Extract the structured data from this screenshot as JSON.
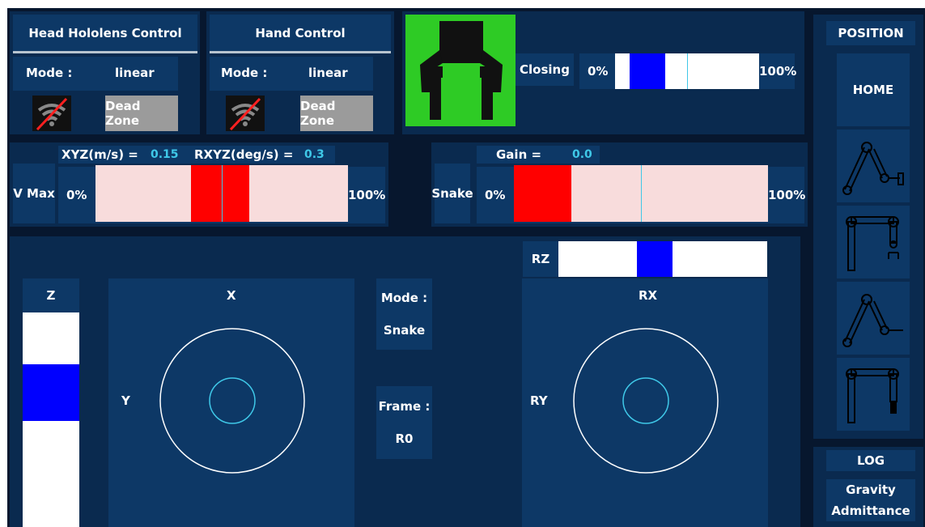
{
  "head_control": {
    "title": "Head Hololens Control",
    "mode_label": "Mode :",
    "mode_value": "linear",
    "dead_zone_label": "Dead Zone",
    "wifi_icon": "wifi-off-icon"
  },
  "hand_control": {
    "title": "Hand Control",
    "mode_label": "Mode :",
    "mode_value": "linear",
    "dead_zone_label": "Dead Zone",
    "wifi_icon": "wifi-off-icon"
  },
  "gripper": {
    "state_label": "Closing",
    "min_label": "0%",
    "max_label": "100%",
    "level": 0.2,
    "icon": "gripper-icon",
    "icon_bg": "#2ecb25"
  },
  "vmax": {
    "label": "V Max",
    "xyz_label": "XYZ(m/s) =",
    "xyz_value": "0.15",
    "rxyz_label": "RXYZ(deg/s) =",
    "rxyz_value": "0.3",
    "min_label": "0%",
    "max_label": "100%",
    "level": 0.55
  },
  "snake": {
    "label": "Snake",
    "gain_label": "Gain =",
    "gain_value": "0.0",
    "min_label": "0%",
    "max_label": "100%",
    "level": 0.18
  },
  "joystick": {
    "z_label": "Z",
    "z_level": 0.5,
    "x_label": "X",
    "y_label": "Y",
    "mode_label": "Mode :",
    "mode_value": "Snake",
    "frame_label": "Frame :",
    "frame_value": "R0",
    "rz_label": "RZ",
    "rz_level": 0.5,
    "rx_label": "RX",
    "ry_label": "RY"
  },
  "sidebar": {
    "position_label": "POSITION",
    "home_label": "HOME",
    "poses": [
      {
        "icon": "robot-arm-pose-1-icon"
      },
      {
        "icon": "robot-arm-pose-2-icon"
      },
      {
        "icon": "robot-arm-pose-3-icon"
      },
      {
        "icon": "robot-arm-pose-4-icon"
      }
    ],
    "log_label": "LOG",
    "gravity_label": "Gravity",
    "admittance_label": "Admittance"
  },
  "colors": {
    "panel": "#0a2a4f",
    "button": "#0d3866",
    "accent_blue": "#0000ff",
    "accent_red": "#ff0000",
    "track_pink": "#f8dcdc",
    "cyan": "#3fc8e8"
  }
}
